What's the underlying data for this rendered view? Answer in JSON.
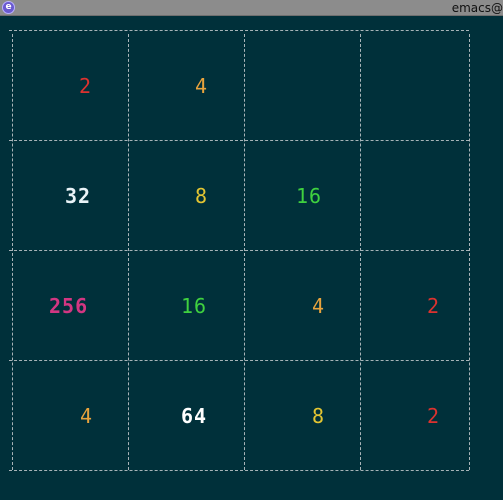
{
  "window": {
    "title": "emacs@",
    "icon": "emacs-icon"
  },
  "colors": {
    "background": "#00303a",
    "grid": "#a8b4b8",
    "tile_2": "#dc322f",
    "tile_4": "#e8a33d",
    "tile_8": "#e3c532",
    "tile_16": "#3fd13f",
    "tile_32": "#e9f3f7",
    "tile_64": "#ffffff",
    "tile_256": "#d33682"
  },
  "board": {
    "rows": [
      [
        "2",
        "4",
        "",
        ""
      ],
      [
        "32",
        "8",
        "16",
        ""
      ],
      [
        "256",
        "16",
        "4",
        "2"
      ],
      [
        "4",
        "64",
        "8",
        "2"
      ]
    ]
  }
}
